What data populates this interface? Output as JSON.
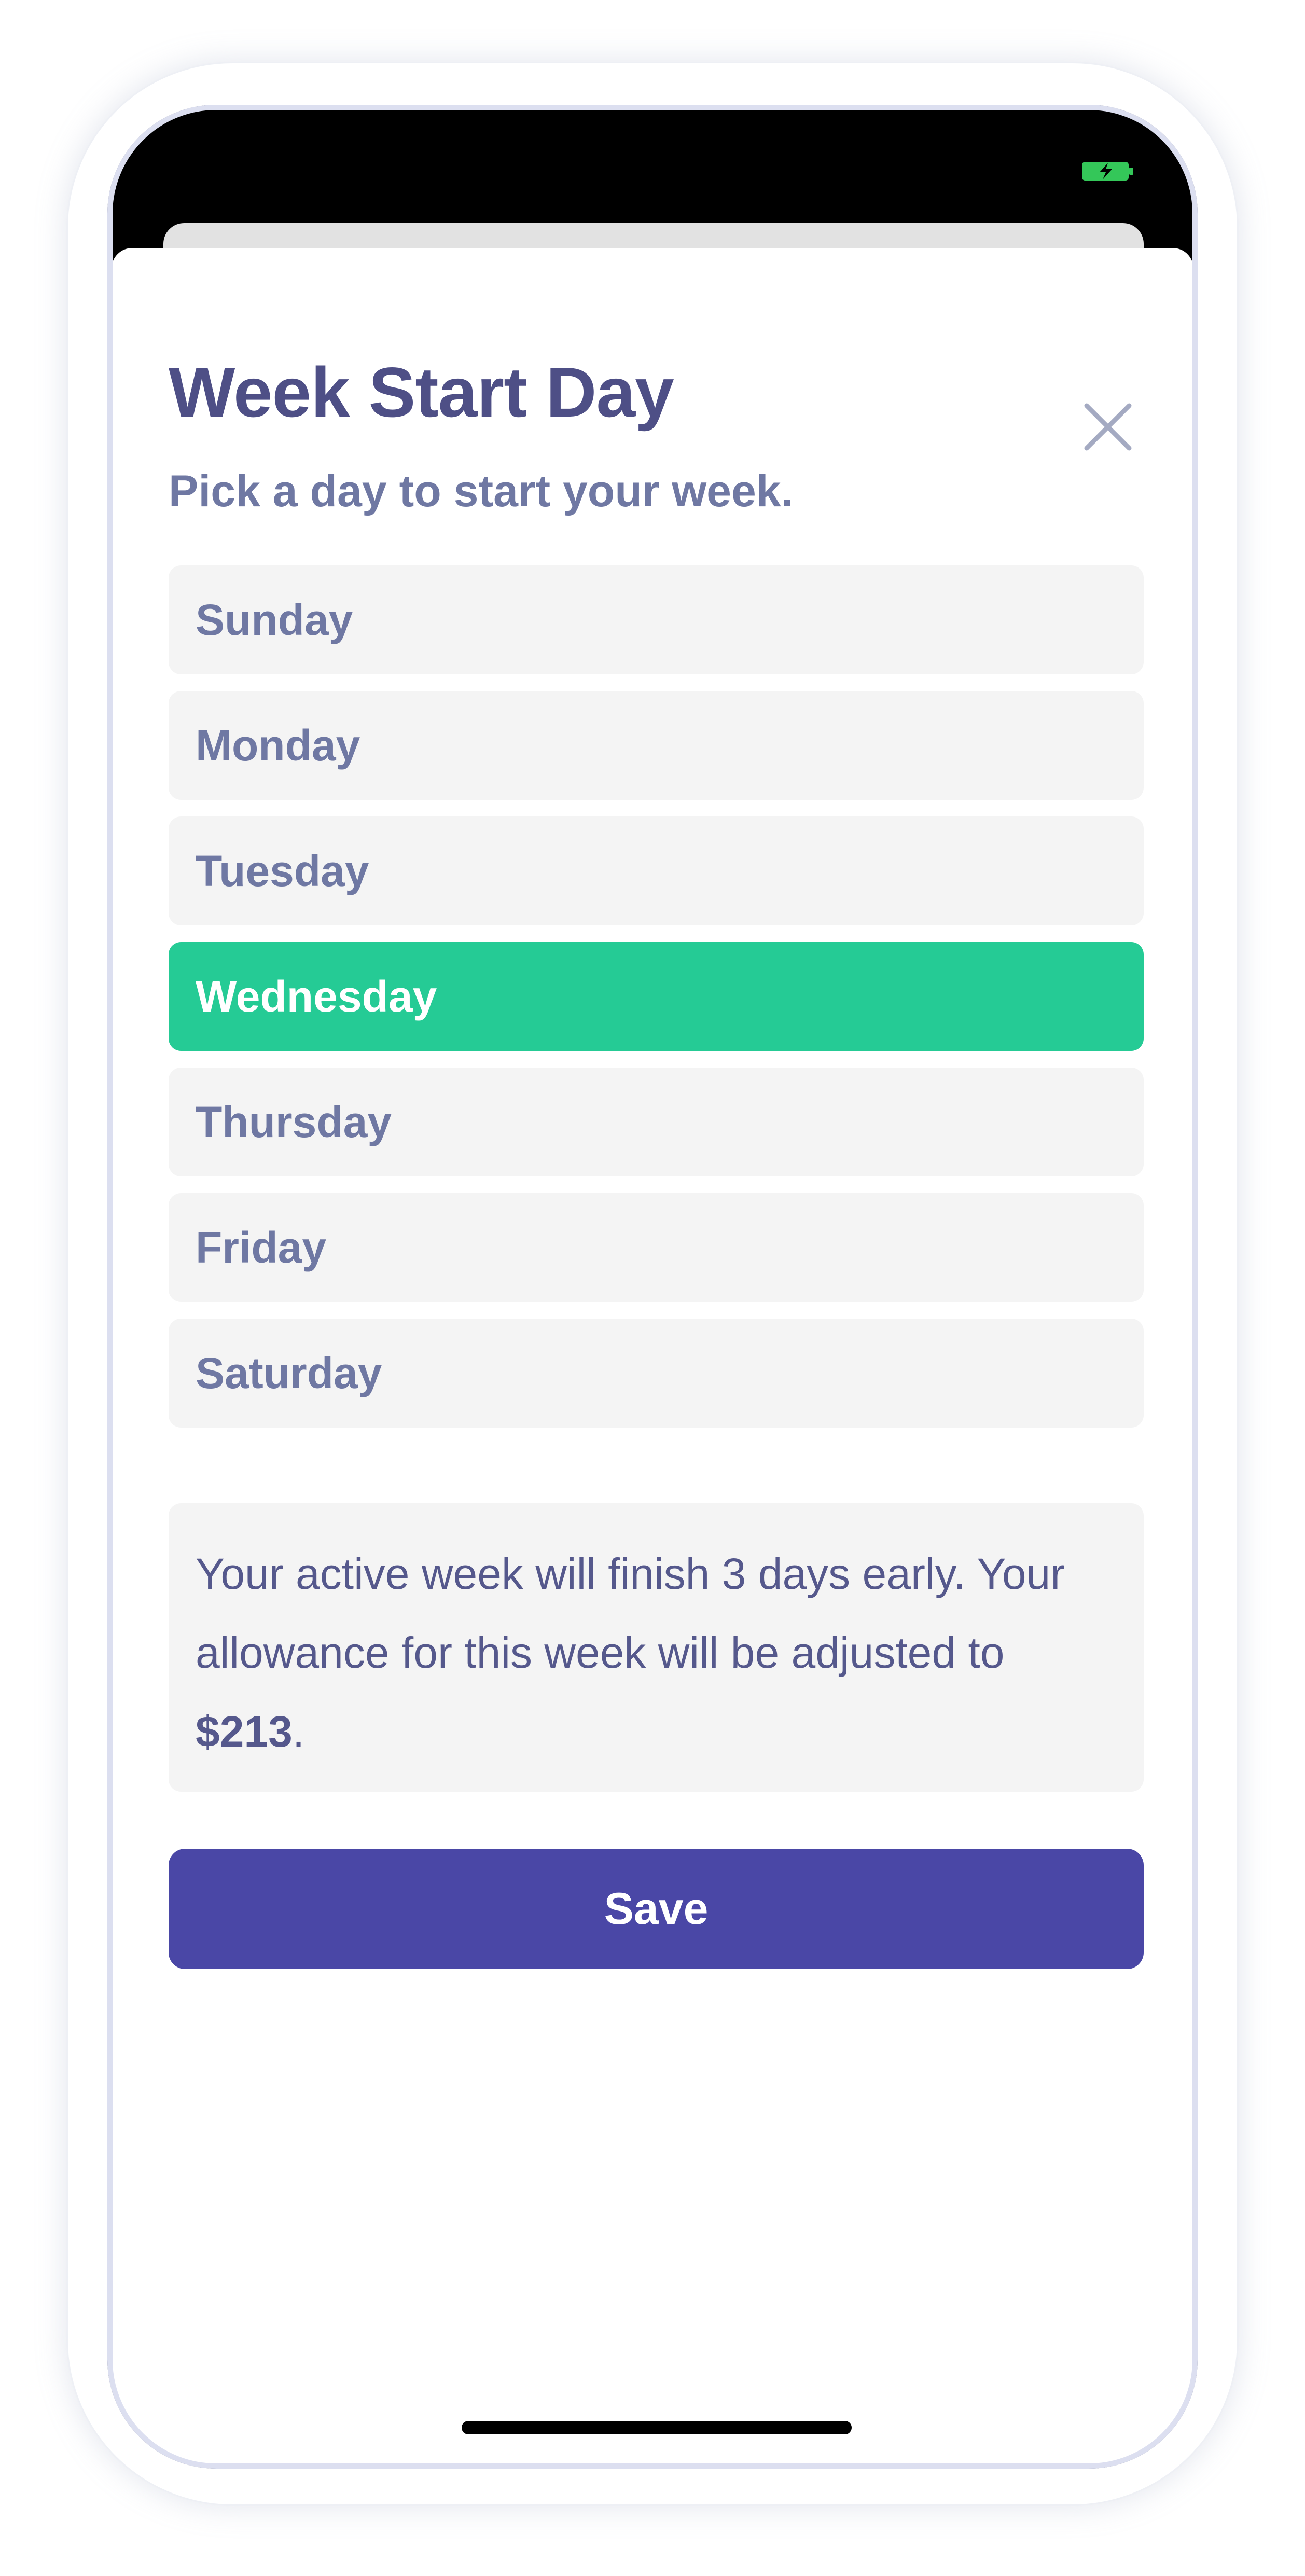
{
  "status_bar": {
    "battery_icon": "battery-charging-icon",
    "battery_color": "#34c759"
  },
  "sheet": {
    "title": "Week Start Day",
    "subtitle": "Pick a day to start your week.",
    "close_icon": "close-icon",
    "days": [
      {
        "label": "Sunday",
        "selected": false
      },
      {
        "label": "Monday",
        "selected": false
      },
      {
        "label": "Tuesday",
        "selected": false
      },
      {
        "label": "Wednesday",
        "selected": true
      },
      {
        "label": "Thursday",
        "selected": false
      },
      {
        "label": "Friday",
        "selected": false
      },
      {
        "label": "Saturday",
        "selected": false
      }
    ],
    "info": {
      "text_before": "Your active week will finish 3 days early. Your allowance for this week will be adjusted to ",
      "amount": "$213",
      "text_after": "."
    },
    "save_label": "Save"
  },
  "colors": {
    "accent": "#25cb95",
    "primary_button": "#4a47a6",
    "title": "#4e4f86",
    "muted_text": "#6f78a3"
  }
}
